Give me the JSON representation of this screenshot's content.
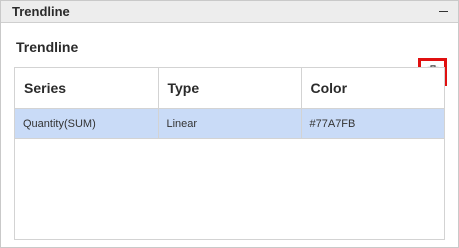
{
  "panel": {
    "title": "Trendline"
  },
  "section": {
    "title": "Trendline"
  },
  "toolbar": {
    "add_icon": "plus-icon",
    "edit_icon": "pencil-icon",
    "delete_icon": "trash-icon",
    "highlight_color": "#e01010"
  },
  "table": {
    "columns": [
      "Series",
      "Type",
      "Color"
    ],
    "rows": [
      {
        "series": "Quantity(SUM)",
        "type": "Linear",
        "color": "#77A7FB"
      }
    ],
    "selected_row_color": "#c9dbf7"
  }
}
